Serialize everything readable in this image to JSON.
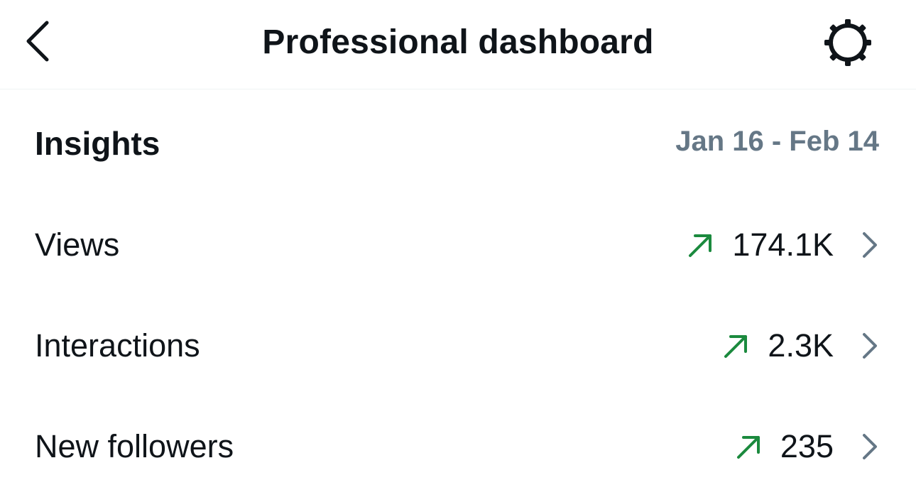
{
  "header": {
    "title": "Professional dashboard",
    "back_icon": "chevron-left-icon",
    "settings_icon": "gear-icon"
  },
  "insights": {
    "title": "Insights",
    "date_range": "Jan 16 - Feb 14"
  },
  "metrics": [
    {
      "label": "Views",
      "value": "174.1K",
      "trend": "up"
    },
    {
      "label": "Interactions",
      "value": "2.3K",
      "trend": "up"
    },
    {
      "label": "New followers",
      "value": "235",
      "trend": "up"
    }
  ],
  "colors": {
    "text": "#0f1419",
    "secondary": "#657786",
    "trend_up": "#1b8a3e",
    "divider": "#eff3f4"
  }
}
